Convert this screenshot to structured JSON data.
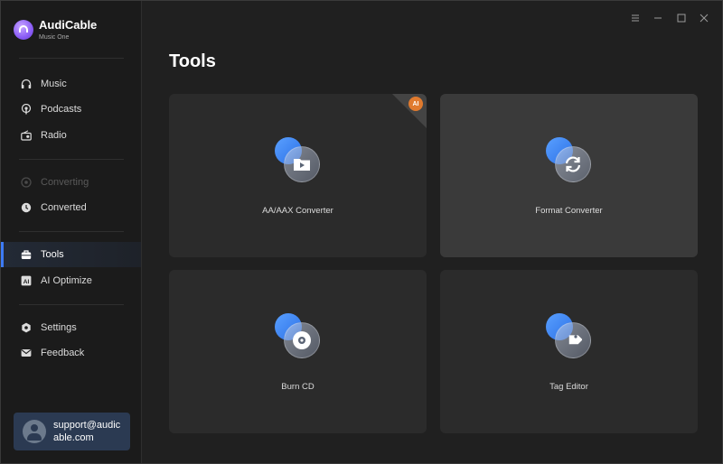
{
  "brand": {
    "name": "AudiCable",
    "subtitle": "Music One"
  },
  "sidebar": {
    "items": [
      {
        "label": "Music",
        "icon": "headphones-icon"
      },
      {
        "label": "Podcasts",
        "icon": "podcast-icon"
      },
      {
        "label": "Radio",
        "icon": "radio-icon"
      },
      {
        "label": "Converting",
        "icon": "converting-icon",
        "disabled": true
      },
      {
        "label": "Converted",
        "icon": "clock-icon"
      },
      {
        "label": "Tools",
        "icon": "toolbox-icon",
        "active": true
      },
      {
        "label": "AI Optimize",
        "icon": "ai-icon"
      },
      {
        "label": "Settings",
        "icon": "gear-icon"
      },
      {
        "label": "Feedback",
        "icon": "mail-icon"
      }
    ]
  },
  "user": {
    "email": "support@audicable.com"
  },
  "page": {
    "title": "Tools"
  },
  "tools": [
    {
      "label": "AA/AAX Converter",
      "icon": "play-file-icon",
      "badge": "AI"
    },
    {
      "label": "Format Converter",
      "icon": "refresh-icon"
    },
    {
      "label": "Burn CD",
      "icon": "disc-icon"
    },
    {
      "label": "Tag Editor",
      "icon": "tag-icon"
    }
  ],
  "window": {
    "controls": [
      "menu-icon",
      "minimize-icon",
      "maximize-icon",
      "close-icon"
    ]
  },
  "colors": {
    "accent": "#3d7bf5",
    "sidebar_bg": "#1b1b1b",
    "main_bg": "#202020",
    "card_bg": "#2b2b2b",
    "user_card_bg": "#2b3a52"
  }
}
